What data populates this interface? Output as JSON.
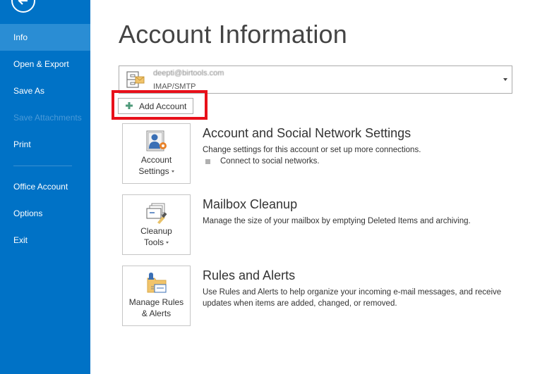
{
  "sidebar": {
    "back_label": "Back",
    "items": [
      {
        "label": "Info",
        "state": "active"
      },
      {
        "label": "Open & Export",
        "state": "normal"
      },
      {
        "label": "Save As",
        "state": "normal"
      },
      {
        "label": "Save Attachments",
        "state": "disabled"
      },
      {
        "label": "Print",
        "state": "normal"
      },
      {
        "label": "Office Account",
        "state": "normal"
      },
      {
        "label": "Options",
        "state": "normal"
      },
      {
        "label": "Exit",
        "state": "normal"
      }
    ]
  },
  "main": {
    "title": "Account Information",
    "account_selector": {
      "email": "deepti@birtools.com",
      "type": "IMAP/SMTP"
    },
    "add_account_label": "Add Account",
    "sections": [
      {
        "tile_line1": "Account",
        "tile_line2": "Settings",
        "title": "Account and Social Network Settings",
        "description": "Change settings for this account or set up more connections.",
        "bullet": "Connect to social networks."
      },
      {
        "tile_line1": "Cleanup",
        "tile_line2": "Tools",
        "title": "Mailbox Cleanup",
        "description": "Manage the size of your mailbox by emptying Deleted Items and archiving."
      },
      {
        "tile_line1": "Manage Rules",
        "tile_line2": "& Alerts",
        "title": "Rules and Alerts",
        "description": "Use Rules and Alerts to help organize your incoming e-mail messages, and receive updates when items are added, changed, or removed."
      }
    ]
  },
  "colors": {
    "sidebar": "#0072c6",
    "sidebar_active": "#2a8dd4",
    "highlight": "#e8101a"
  }
}
